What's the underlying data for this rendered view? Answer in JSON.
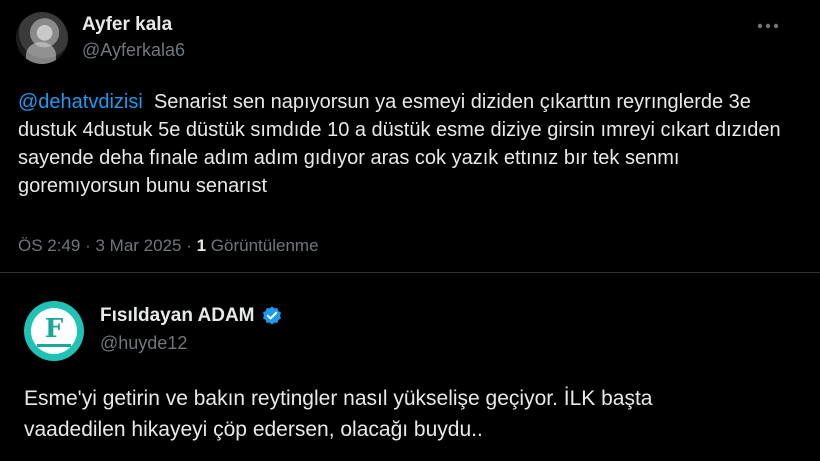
{
  "tweet": {
    "display_name": "Ayfer kala",
    "handle": "@Ayferkala6",
    "more_icon": "more-horizontal-icon",
    "mention": "@dehatvdizisi",
    "text": "Senarist sen napıyorsun ya esmeyi diziden çıkarttın reyrınglerde 3e dustuk 4dustuk 5e düstük sımdıde 10 a düstük esme diziye girsin ımreyi cıkart dızıden sayende deha fınale adım adım gıdıyor aras cok yazık ettınız bır tek senmı goremıyorsun bunu senarıst",
    "time": "ÖS 2:49",
    "date": "3 Mar 2025",
    "views_count": "1",
    "views_label": "Görüntülenme"
  },
  "quote": {
    "display_name": "Fısıldayan ADAM",
    "handle": "@huyde12",
    "avatar_letter": "F",
    "verified_icon": "verified-badge-icon",
    "verified_color": "#1d9bf0",
    "text_line1": "Esme'yi getirin ve bakın reytingler nasıl yükselişe geçiyor. İLK başta",
    "text_line2": "vaadedilen hikayeyi çöp edersen, olacağı buydu.."
  }
}
